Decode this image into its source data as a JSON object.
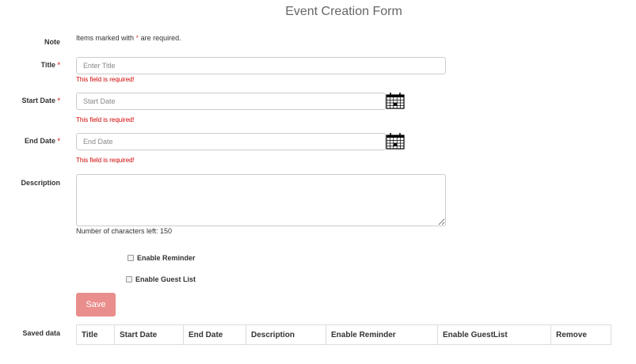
{
  "form": {
    "title": "Event Creation Form",
    "required_marker": "*",
    "note": {
      "label": "Note",
      "text_before": "Items marked with",
      "text_after": "are required."
    },
    "title_field": {
      "label": "Title",
      "placeholder": "Enter Title",
      "value": "",
      "error": "This field is required!"
    },
    "start_date_field": {
      "label": "Start Date",
      "placeholder": "Start Date",
      "value": "",
      "error": "This field is required!"
    },
    "end_date_field": {
      "label": "End Date",
      "placeholder": "End Date",
      "value": "",
      "error": "This field is required!"
    },
    "description_field": {
      "label": "Description",
      "value": "",
      "counter_text": "Number of characters left: 150"
    },
    "enable_reminder": {
      "label": "Enable Reminder",
      "checked": false
    },
    "enable_guest_list": {
      "label": "Enable Guest List",
      "checked": false
    },
    "save_label": "Save",
    "accent_error": "#d00000",
    "save_button_color": "#e98e8c"
  },
  "saved_data": {
    "label": "Saved data",
    "columns": [
      "Title",
      "Start Date",
      "End Date",
      "Description",
      "Enable Reminder",
      "Enable GuestList",
      "Remove"
    ],
    "rows": []
  }
}
